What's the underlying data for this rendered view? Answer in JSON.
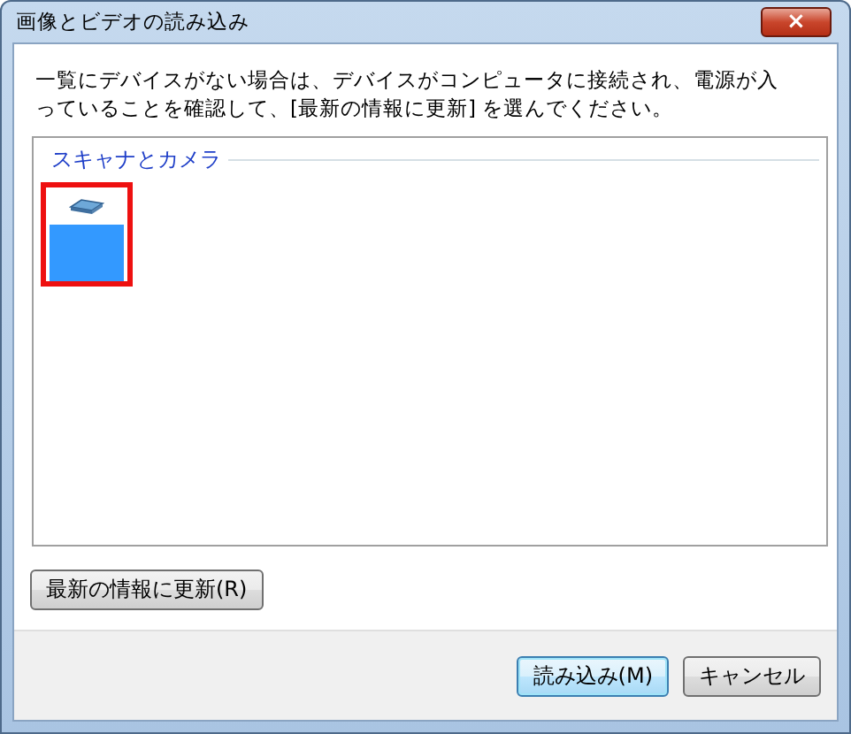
{
  "window": {
    "title": "画像とビデオの読み込み",
    "close": "×"
  },
  "message": "一覧にデバイスがない場合は、デバイスがコンピュータに接続され、電源が入っていることを確認して、[最新の情報に更新] を選んでください。",
  "device_list": {
    "group": "スキャナとカメラ",
    "devices": [
      {
        "kind": "scanner",
        "selected": true,
        "highlighted": true
      }
    ]
  },
  "refresh_button": "最新の情報に更新(R)",
  "buttons": [
    {
      "label": "読み込み(M)",
      "default": true
    },
    {
      "label": "キャンセル",
      "default": false
    }
  ]
}
